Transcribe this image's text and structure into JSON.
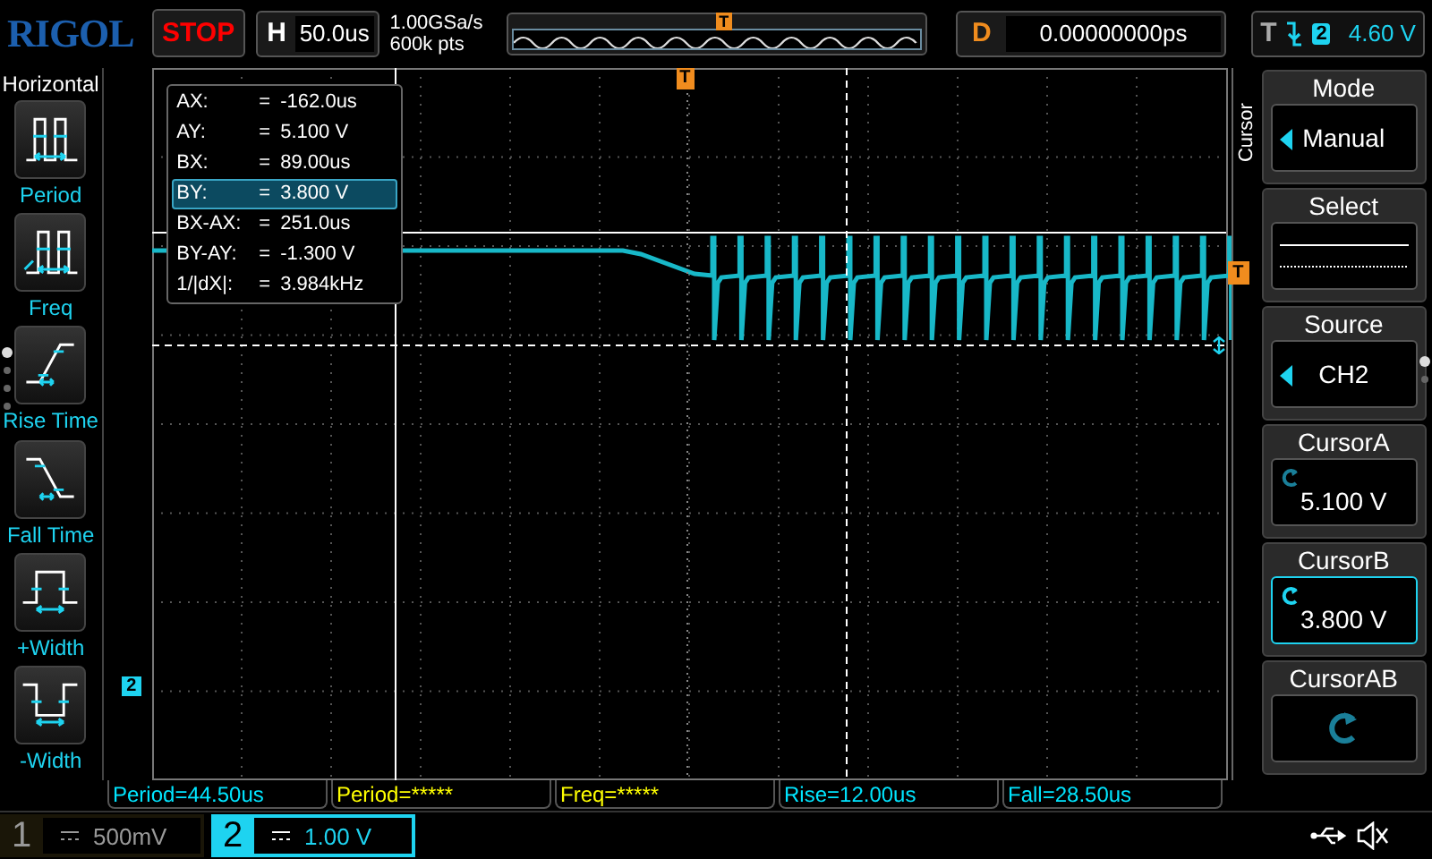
{
  "brand": "RIGOL",
  "run_state": "STOP",
  "timebase": {
    "label": "H",
    "value": "50.0us"
  },
  "acquisition": {
    "sample_rate": "1.00GSa/s",
    "memory_depth": "600k pts"
  },
  "overview": {
    "trigger_marker": "T"
  },
  "delay": {
    "label": "D",
    "value": "0.00000000ps"
  },
  "trigger": {
    "label": "T",
    "channel": "2",
    "level": "4.60 V"
  },
  "left_panel": {
    "title": "Horizontal",
    "items": [
      {
        "label": "Period",
        "kind": "period"
      },
      {
        "label": "Freq",
        "kind": "freq"
      },
      {
        "label": "Rise Time",
        "kind": "rise"
      },
      {
        "label": "Fall Time",
        "kind": "fall"
      },
      {
        "label": "+Width",
        "kind": "pwidth"
      },
      {
        "label": "-Width",
        "kind": "nwidth"
      }
    ]
  },
  "scope": {
    "trigger_position_marker": "T",
    "trigger_level_marker": "T",
    "channel_marker": "2",
    "cursor_readout": [
      {
        "name": "AX:",
        "eq": "=",
        "value": "-162.0us",
        "selected": false
      },
      {
        "name": "AY:",
        "eq": "=",
        "value": "5.100 V",
        "selected": false
      },
      {
        "name": "BX:",
        "eq": "=",
        "value": "89.00us",
        "selected": false
      },
      {
        "name": "BY:",
        "eq": "=",
        "value": "3.800 V",
        "selected": true
      },
      {
        "name": "BX-AX:",
        "eq": "=",
        "value": "251.0us",
        "selected": false
      },
      {
        "name": "BY-AY:",
        "eq": "=",
        "value": "-1.300 V",
        "selected": false
      },
      {
        "name": "1/|dX|:",
        "eq": "=",
        "value": "3.984kHz",
        "selected": false
      }
    ]
  },
  "right_menu": {
    "title": "Cursor",
    "items": [
      {
        "title": "Mode",
        "kind": "select",
        "value": "Manual",
        "selected": false
      },
      {
        "title": "Select",
        "kind": "lines",
        "selected": false
      },
      {
        "title": "Source",
        "kind": "select",
        "value": "CH2",
        "selected": false
      },
      {
        "title": "CursorA",
        "kind": "knob",
        "value": "5.100 V",
        "selected": false
      },
      {
        "title": "CursorB",
        "kind": "knob",
        "value": "3.800 V",
        "selected": true
      },
      {
        "title": "CursorAB",
        "kind": "knob-only",
        "selected": false
      }
    ]
  },
  "measurements": [
    {
      "text": "Period=44.50us",
      "color": "#00e5ff"
    },
    {
      "text": "Period=*****",
      "color": "#ffff00"
    },
    {
      "text": "Freq=*****",
      "color": "#ffff00"
    },
    {
      "text": "Rise=12.00us",
      "color": "#00e5ff"
    },
    {
      "text": "Fall=28.50us",
      "color": "#00e5ff"
    }
  ],
  "channels": [
    {
      "number": "1",
      "scale": "500mV",
      "on": false
    },
    {
      "number": "2",
      "scale": "1.00 V",
      "on": true
    }
  ]
}
